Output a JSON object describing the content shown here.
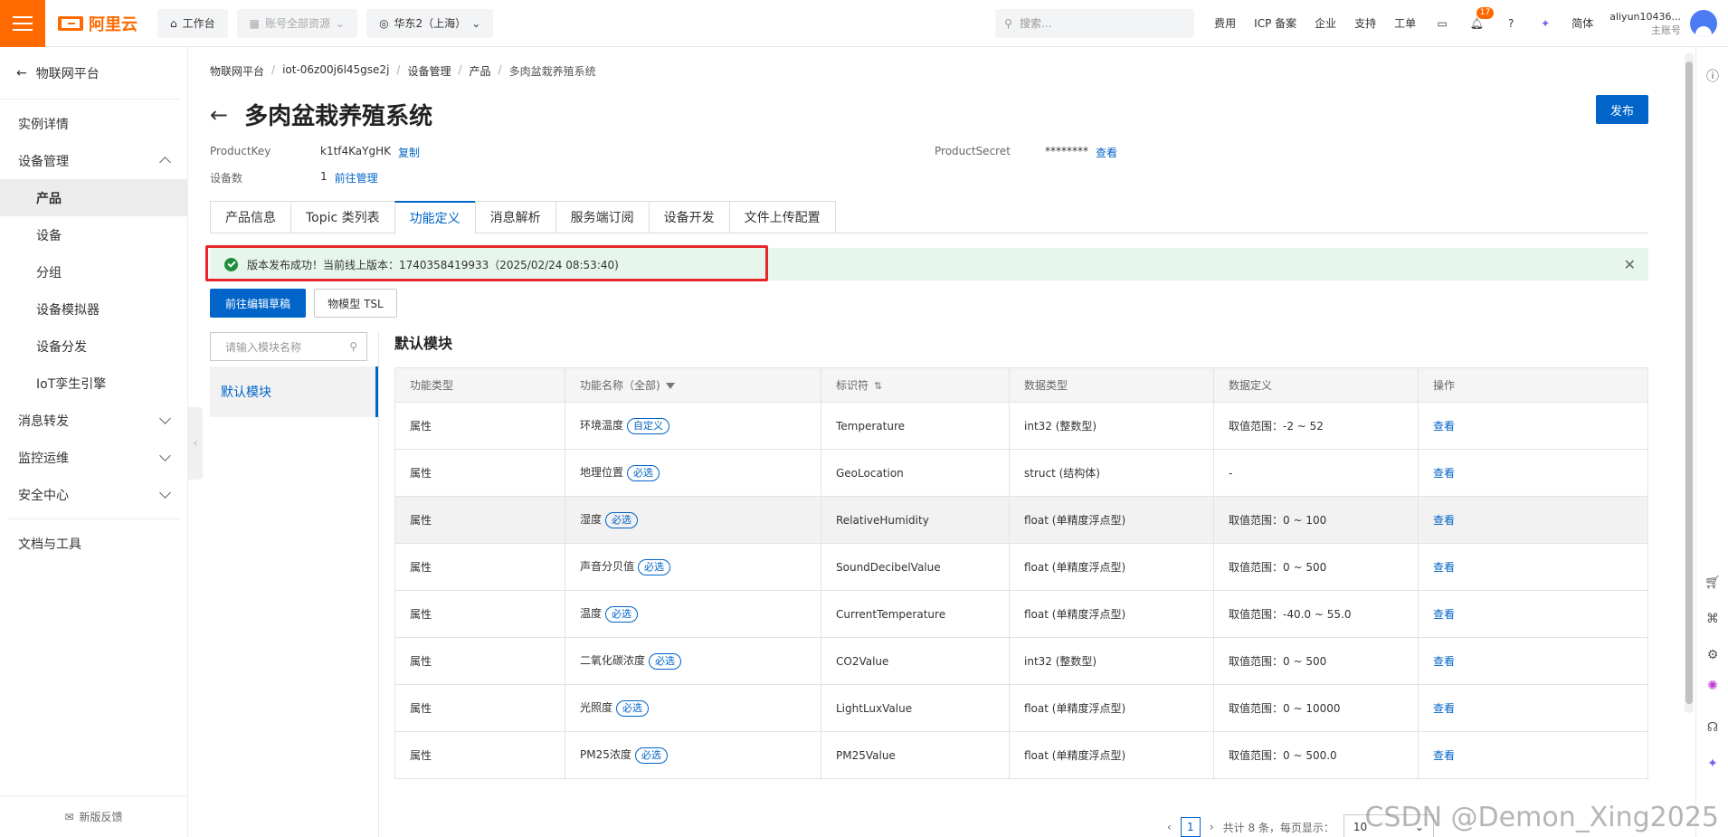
{
  "topbar": {
    "logo_text": "阿里云",
    "workbench": "工作台",
    "account_resources": "账号全部资源",
    "region": "华东2（上海）",
    "search_placeholder": "搜索...",
    "links": [
      "费用",
      "ICP 备案",
      "企业",
      "支持",
      "工单"
    ],
    "notification_count": "17",
    "language": "简体",
    "username": "aliyun10436...",
    "account_type": "主账号"
  },
  "sidebar": {
    "back_label": "物联网平台",
    "items": [
      {
        "label": "实例详情",
        "level": 1
      },
      {
        "label": "设备管理",
        "level": 1,
        "expanded": true
      },
      {
        "label": "产品",
        "level": 2,
        "active": true
      },
      {
        "label": "设备",
        "level": 2
      },
      {
        "label": "分组",
        "level": 2
      },
      {
        "label": "设备模拟器",
        "level": 2
      },
      {
        "label": "设备分发",
        "level": 2
      },
      {
        "label": "IoT孪生引擎",
        "level": 2
      },
      {
        "label": "消息转发",
        "level": 1,
        "expandable": true
      },
      {
        "label": "监控运维",
        "level": 1,
        "expandable": true
      },
      {
        "label": "安全中心",
        "level": 1,
        "expandable": true
      }
    ],
    "docs": "文档与工具",
    "feedback": "新版反馈"
  },
  "breadcrumb": [
    "物联网平台",
    "iot-06z00j6l45gse2j",
    "设备管理",
    "产品",
    "多肉盆栽养殖系统"
  ],
  "page": {
    "title": "多肉盆栽养殖系统",
    "publish": "发布",
    "product_key_label": "ProductKey",
    "product_key": "k1tf4KaYgHK",
    "copy": "复制",
    "product_secret_label": "ProductSecret",
    "product_secret": "********",
    "view": "查看",
    "device_count_label": "设备数",
    "device_count": "1",
    "manage_link": "前往管理"
  },
  "tabs": [
    "产品信息",
    "Topic 类列表",
    "功能定义",
    "消息解析",
    "服务端订阅",
    "设备开发",
    "文件上传配置"
  ],
  "active_tab": "功能定义",
  "notice": {
    "text": "版本发布成功！当前线上版本：1740358419933（2025/02/24 08:53:40)"
  },
  "actions": {
    "edit_draft": "前往编辑草稿",
    "tsl": "物模型 TSL"
  },
  "modules": {
    "search_placeholder": "请输入模块名称",
    "items": [
      "默认模块"
    ],
    "current_title": "默认模块"
  },
  "table": {
    "headers": [
      "功能类型",
      "功能名称（全部)",
      "标识符",
      "数据类型",
      "数据定义",
      "操作"
    ],
    "rows": [
      {
        "type": "属性",
        "name": "环境温度",
        "tag": "自定义",
        "id": "Temperature",
        "dtype": "int32 (整数型)",
        "def": "取值范围：-2 ~ 52",
        "op": "查看"
      },
      {
        "type": "属性",
        "name": "地理位置",
        "tag": "必选",
        "id": "GeoLocation",
        "dtype": "struct (结构体)",
        "def": "-",
        "op": "查看"
      },
      {
        "type": "属性",
        "name": "湿度",
        "tag": "必选",
        "id": "RelativeHumidity",
        "dtype": "float (单精度浮点型)",
        "def": "取值范围：0 ~ 100",
        "op": "查看"
      },
      {
        "type": "属性",
        "name": "声音分贝值",
        "tag": "必选",
        "id": "SoundDecibelValue",
        "dtype": "float (单精度浮点型)",
        "def": "取值范围：0 ~ 500",
        "op": "查看"
      },
      {
        "type": "属性",
        "name": "温度",
        "tag": "必选",
        "id": "CurrentTemperature",
        "dtype": "float (单精度浮点型)",
        "def": "取值范围：-40.0 ~ 55.0",
        "op": "查看"
      },
      {
        "type": "属性",
        "name": "二氧化碳浓度",
        "tag": "必选",
        "id": "CO2Value",
        "dtype": "int32 (整数型)",
        "def": "取值范围：0 ~ 500",
        "op": "查看"
      },
      {
        "type": "属性",
        "name": "光照度",
        "tag": "必选",
        "id": "LightLuxValue",
        "dtype": "float (单精度浮点型)",
        "def": "取值范围：0 ~ 10000",
        "op": "查看"
      },
      {
        "type": "属性",
        "name": "PM25浓度",
        "tag": "必选",
        "id": "PM25Value",
        "dtype": "float (单精度浮点型)",
        "def": "取值范围：0 ~ 500.0",
        "op": "查看"
      }
    ]
  },
  "pager": {
    "current": "1",
    "total_text": "共计 8 条，每页显示：",
    "page_size": "10"
  },
  "watermark": "CSDN @Demon_Xing2025",
  "colors": {
    "accent": "#0064c8",
    "brand": "#ff6a00",
    "success_bg": "#e7f6ec",
    "highlight_border": "#e8252b"
  }
}
